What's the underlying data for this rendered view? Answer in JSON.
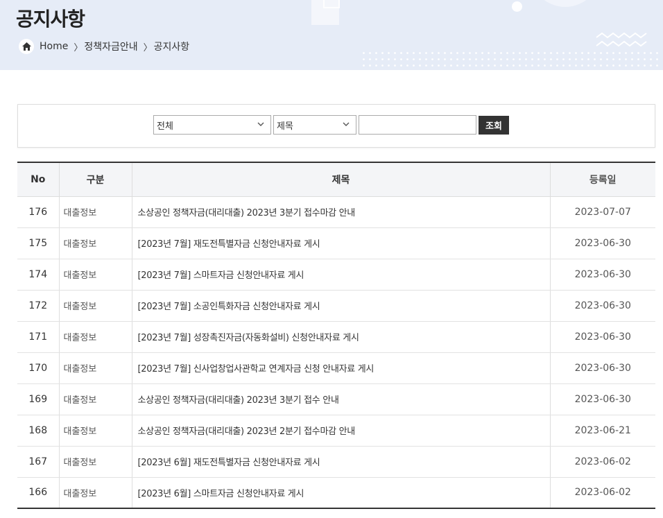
{
  "header": {
    "title": "공지사항",
    "breadcrumb": [
      "Home",
      "정책자금안내",
      "공지사항"
    ]
  },
  "search": {
    "category_value": "전체",
    "field_value": "제목",
    "query_value": "",
    "button_label": "조회"
  },
  "table": {
    "columns": [
      "No",
      "구분",
      "제목",
      "등록일"
    ],
    "rows": [
      {
        "no": "176",
        "category": "대출정보",
        "title": "소상공인 정책자금(대리대출) 2023년 3분기 접수마감 안내",
        "date": "2023-07-07"
      },
      {
        "no": "175",
        "category": "대출정보",
        "title": "[2023년 7월] 재도전특별자금 신청안내자료 게시",
        "date": "2023-06-30"
      },
      {
        "no": "174",
        "category": "대출정보",
        "title": "[2023년 7월] 스마트자금 신청안내자료 게시",
        "date": "2023-06-30"
      },
      {
        "no": "172",
        "category": "대출정보",
        "title": "[2023년 7월] 소공인특화자금 신청안내자료 게시",
        "date": "2023-06-30"
      },
      {
        "no": "171",
        "category": "대출정보",
        "title": "[2023년 7월] 성장촉진자금(자동화설비) 신청안내자료 게시",
        "date": "2023-06-30"
      },
      {
        "no": "170",
        "category": "대출정보",
        "title": "[2023년 7월] 신사업창업사관학교 연계자금 신청 안내자료 게시",
        "date": "2023-06-30"
      },
      {
        "no": "169",
        "category": "대출정보",
        "title": "소상공인 정책자금(대리대출) 2023년 3분기 접수 안내",
        "date": "2023-06-30"
      },
      {
        "no": "168",
        "category": "대출정보",
        "title": "소상공인 정책자금(대리대출) 2023년 2분기 접수마감 안내",
        "date": "2023-06-21"
      },
      {
        "no": "167",
        "category": "대출정보",
        "title": "[2023년 6월] 재도전특별자금 신청안내자료 게시",
        "date": "2023-06-02"
      },
      {
        "no": "166",
        "category": "대출정보",
        "title": "[2023년 6월] 스마트자금 신청안내자료 게시",
        "date": "2023-06-02"
      }
    ]
  },
  "icons": {
    "home": "home-icon",
    "chevron": "chevron-down-icon"
  }
}
